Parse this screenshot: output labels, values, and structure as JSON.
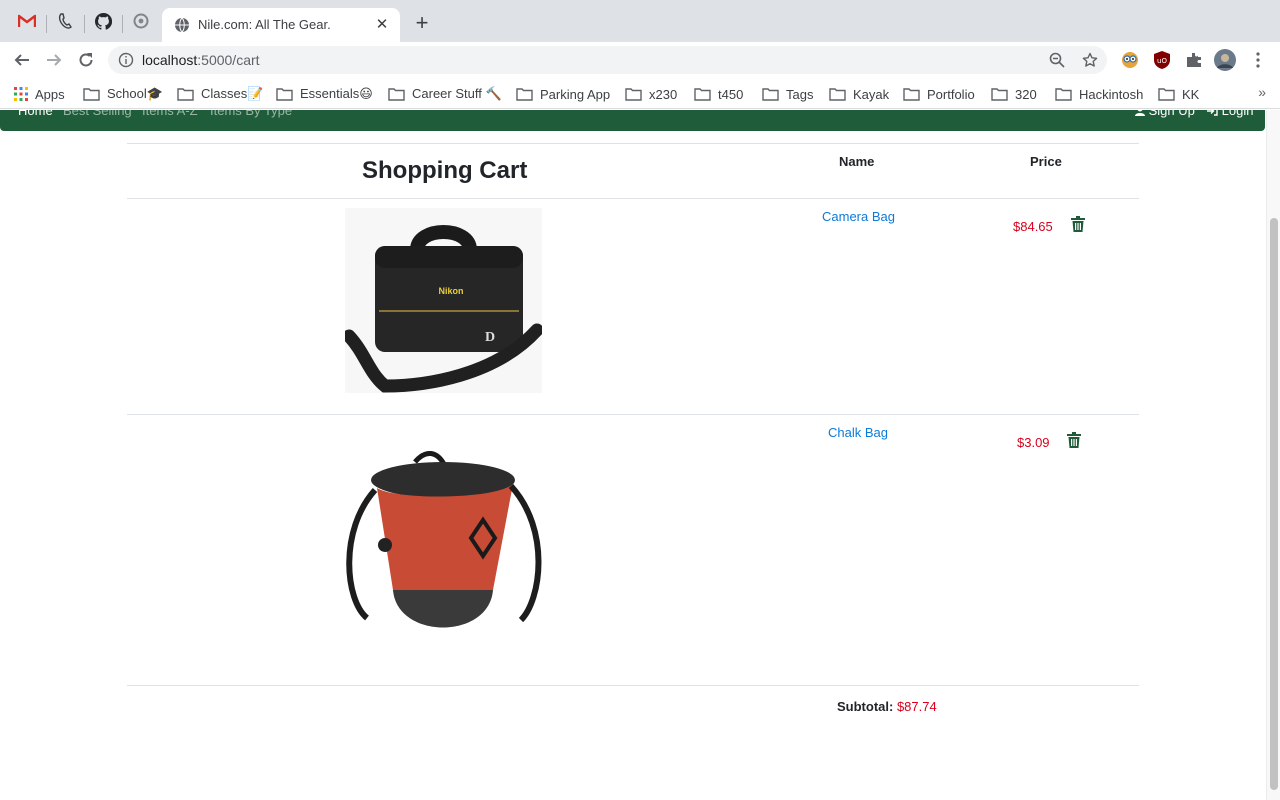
{
  "browser": {
    "tab_title": "Nile.com: All The Gear.",
    "url_host": "localhost",
    "url_path": ":5000/cart",
    "bookmarks": [
      "Apps",
      "School🎓",
      "Classes📝",
      "Essentials😃",
      "Career Stuff 🔨",
      "Parking App",
      "x230",
      "t450",
      "Tags",
      "Kayak",
      "Portfolio",
      "320",
      "Hackintosh",
      "KK"
    ],
    "overflow_glyph": "»"
  },
  "site_nav": {
    "links": [
      "Home",
      "Best Selling",
      "Items A-Z",
      "Items By Type"
    ],
    "sign_up": "Sign Up",
    "login": "Login"
  },
  "cart": {
    "heading": "Shopping Cart",
    "col_name": "Name",
    "col_price": "Price",
    "items": [
      {
        "name": "Camera Bag",
        "price": "$84.65",
        "brand_text": "Nikon",
        "badge": "D"
      },
      {
        "name": "Chalk Bag",
        "price": "$3.09"
      }
    ],
    "subtotal_label": "Subtotal:",
    "subtotal_value": "$87.74"
  },
  "colors": {
    "nav_green": "#1e5c3a",
    "price_red": "#d9001b",
    "link_blue": "#0d7ad9",
    "trash_green": "#1e5c3a"
  },
  "icons": [
    "gmail-icon",
    "phone-icon",
    "github-icon",
    "chrome-icon",
    "globe-icon",
    "close-icon",
    "plus-icon",
    "back-icon",
    "forward-icon",
    "reload-icon",
    "info-icon",
    "zoom-icon",
    "star-icon",
    "extension-icon",
    "avatar",
    "menu-icon",
    "folder-icon",
    "apps-grid-icon",
    "user-icon",
    "login-icon",
    "trash-icon"
  ]
}
